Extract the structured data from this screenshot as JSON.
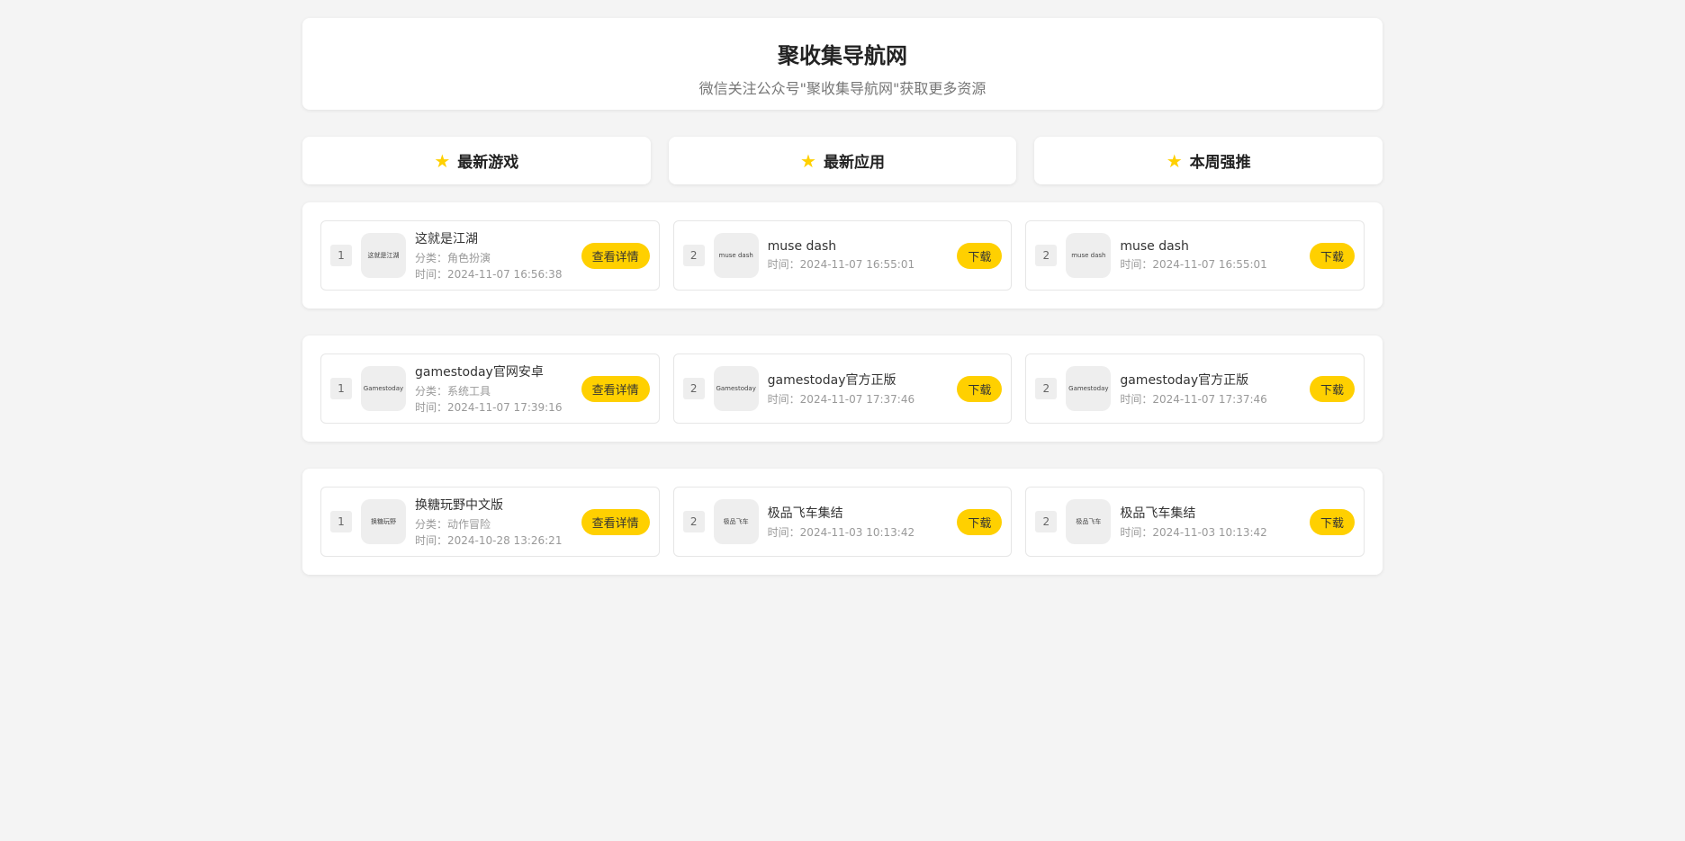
{
  "header": {
    "title": "聚收集导航网",
    "subtitle": "微信关注公众号\"聚收集导航网\"获取更多资源"
  },
  "tabs": [
    {
      "label": "最新游戏"
    },
    {
      "label": "最新应用"
    },
    {
      "label": "本周强推"
    }
  ],
  "rows": [
    [
      {
        "rank": "1",
        "thumb": "这就是江湖",
        "name": "这就是江湖",
        "category": "分类：角色扮演",
        "time": "时间：2024-11-07 16:56:38",
        "button": "查看详情"
      },
      {
        "rank": "2",
        "thumb": "muse dash",
        "name": "muse dash",
        "time": "时间：2024-11-07 16:55:01",
        "button": "下载"
      },
      {
        "rank": "2",
        "thumb": "muse dash",
        "name": "muse dash",
        "time": "时间：2024-11-07 16:55:01",
        "button": "下载"
      }
    ],
    [
      {
        "rank": "1",
        "thumb": "Gamestoday",
        "name": "gamestoday官网安卓",
        "category": "分类：系统工具",
        "time": "时间：2024-11-07 17:39:16",
        "button": "查看详情"
      },
      {
        "rank": "2",
        "thumb": "Gamestoday",
        "name": "gamestoday官方正版",
        "time": "时间：2024-11-07 17:37:46",
        "button": "下载"
      },
      {
        "rank": "2",
        "thumb": "Gamestoday",
        "name": "gamestoday官方正版",
        "time": "时间：2024-11-07 17:37:46",
        "button": "下载"
      }
    ],
    [
      {
        "rank": "1",
        "thumb": "换糖玩野",
        "name": "换糖玩野中文版",
        "category": "分类：动作冒险",
        "time": "时间：2024-10-28 13:26:21",
        "button": "查看详情"
      },
      {
        "rank": "2",
        "thumb": "极品飞车",
        "name": "极品飞车集结",
        "time": "时间：2024-11-03 10:13:42",
        "button": "下载"
      },
      {
        "rank": "2",
        "thumb": "极品飞车",
        "name": "极品飞车集结",
        "time": "时间：2024-11-03 10:13:42",
        "button": "下载"
      }
    ]
  ],
  "colors": {
    "accent": "#ffd000",
    "background": "#f4f4f4"
  },
  "icons": {
    "tab": "star-icon"
  }
}
